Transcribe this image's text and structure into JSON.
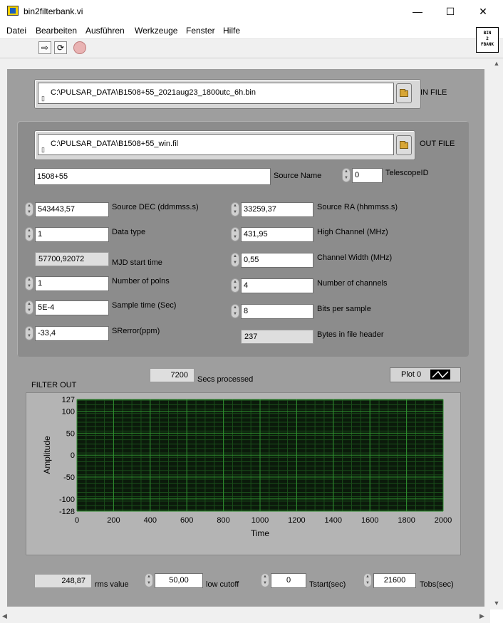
{
  "window": {
    "title": "bin2filterbank.vi",
    "minimize": "—",
    "maximize": "☐",
    "close": "✕"
  },
  "menu": [
    "Datei",
    "Bearbeiten",
    "Ausführen",
    "Werkzeuge",
    "Fenster",
    "Hilfe"
  ],
  "vi_icon_text": "BIN\n2\nFBANK",
  "in_file": {
    "path": "C:\\PULSAR_DATA\\B1508+55_2021aug23_1800utc_6h.bin",
    "label": "IN FILE"
  },
  "out_file": {
    "path": "C:\\PULSAR_DATA\\B1508+55_win.fil",
    "label": "OUT FILE"
  },
  "source_name": {
    "value": "1508+55",
    "label": "Source Name"
  },
  "telescope_id": {
    "value": "0",
    "label": "TelescopeID"
  },
  "left_params": [
    {
      "value": "543443,57",
      "label": "Source DEC (ddmmss.s)",
      "type": "control"
    },
    {
      "value": "1",
      "label": "Data type",
      "type": "control"
    },
    {
      "value": "57700,92072",
      "label": "MJD start time",
      "type": "indicator"
    },
    {
      "value": "1",
      "label": "Number of polns",
      "type": "control"
    },
    {
      "value": "5E-4",
      "label": "Sample time (Sec)",
      "type": "control"
    },
    {
      "value": "-33,4",
      "label": "SRerror(ppm)",
      "type": "control"
    }
  ],
  "right_params": [
    {
      "value": "33259,37",
      "label": "Source RA (hhmmss.s)",
      "type": "control"
    },
    {
      "value": "431,95",
      "label": "High Channel (MHz)",
      "type": "control"
    },
    {
      "value": "0,55",
      "label": "Channel Width (MHz)",
      "type": "control"
    },
    {
      "value": "4",
      "label": "Number of channels",
      "type": "control"
    },
    {
      "value": "8",
      "label": "Bits per sample",
      "type": "control"
    },
    {
      "value": "237",
      "label": "Bytes in file header",
      "type": "indicator"
    }
  ],
  "secs_processed": {
    "value": "7200",
    "label": "Secs processed"
  },
  "graph": {
    "title": "FILTER OUT",
    "legend": "Plot 0",
    "xlabel": "Time",
    "ylabel": "Amplitude",
    "xticks": [
      "0",
      "200",
      "400",
      "600",
      "800",
      "1000",
      "1200",
      "1400",
      "1600",
      "1800",
      "2000"
    ],
    "yticks": [
      "127",
      "100",
      "50",
      "0",
      "-50",
      "-100",
      "-128"
    ],
    "colors": {
      "plot_bg": "#0b1a0b",
      "grid_major": "#2f8f2f",
      "grid_minor": "#1a4d1a"
    }
  },
  "chart_data": {
    "type": "line",
    "title": "FILTER OUT",
    "xlabel": "Time",
    "ylabel": "Amplitude",
    "xlim": [
      0,
      2000
    ],
    "ylim": [
      -128,
      127
    ],
    "x_ticks": [
      0,
      200,
      400,
      600,
      800,
      1000,
      1200,
      1400,
      1600,
      1800,
      2000
    ],
    "y_ticks": [
      127,
      100,
      50,
      0,
      -50,
      -100,
      -128
    ],
    "grid": true,
    "legend": "top-right",
    "series": [
      {
        "name": "Plot 0",
        "x": [],
        "y": []
      }
    ]
  },
  "bottom": {
    "rms": {
      "value": "248,87",
      "label": "rms value"
    },
    "low_cutoff": {
      "value": "50,00",
      "label": "low cutoff"
    },
    "tstart": {
      "value": "0",
      "label": "Tstart(sec)"
    },
    "tobs": {
      "value": "21600",
      "label": "Tobs(sec)"
    }
  }
}
